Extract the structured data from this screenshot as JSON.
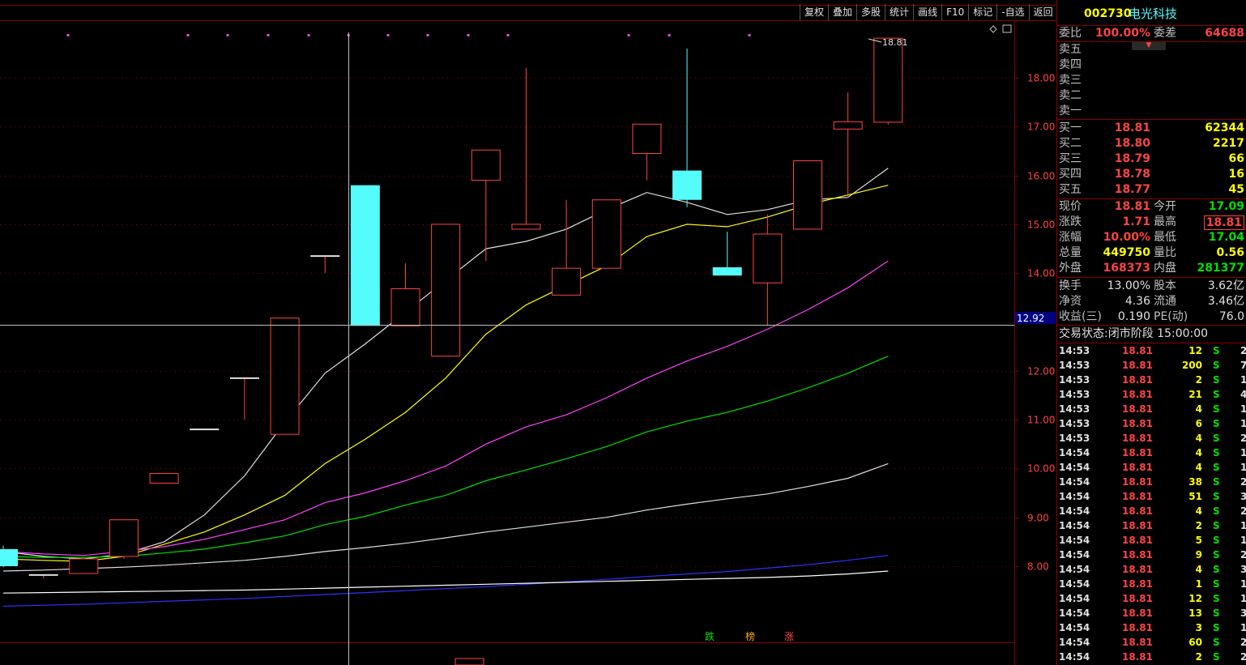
{
  "toolbar": {
    "buttons": [
      "复权",
      "叠加",
      "多股",
      "统计",
      "画线",
      "F10",
      "标记",
      "-自选",
      "返回"
    ]
  },
  "chart_data": {
    "type": "candlestick",
    "y_ticks": [
      "18.00",
      "17.00",
      "16.00",
      "15.00",
      "14.00",
      "12.00",
      "11.00",
      "10.00",
      "9.00",
      "8.00"
    ],
    "y_tick_values": [
      18,
      17,
      16,
      15,
      14,
      12,
      11,
      10,
      9,
      8
    ],
    "ylim": [
      6.3,
      19.1
    ],
    "crosshair_price": "12.92",
    "high_marker": "18.81",
    "bottom_labels": [
      "跌",
      "榜",
      "涨"
    ],
    "candles": [
      {
        "o": 8.35,
        "c": 8.0,
        "h": 8.42,
        "l": 7.98
      },
      {
        "o": 7.82,
        "c": 7.82,
        "h": 7.82,
        "l": 7.75
      },
      {
        "o": 7.85,
        "c": 8.15,
        "h": 8.15,
        "l": 7.85
      },
      {
        "o": 8.2,
        "c": 8.95,
        "h": 8.95,
        "l": 8.15
      },
      {
        "o": 9.7,
        "c": 9.9,
        "h": 9.9,
        "l": 9.7
      },
      {
        "o": 10.8,
        "c": 10.8,
        "h": 10.8,
        "l": 10.8
      },
      {
        "o": 11.85,
        "c": 11.85,
        "h": 11.85,
        "l": 11.0
      },
      {
        "o": 10.7,
        "c": 13.08,
        "h": 13.08,
        "l": 10.7
      },
      {
        "o": 14.35,
        "c": 14.35,
        "h": 14.35,
        "l": 14.0
      },
      {
        "o": 15.8,
        "c": 12.92,
        "h": 15.8,
        "l": 12.92
      },
      {
        "o": 12.92,
        "c": 13.68,
        "h": 14.2,
        "l": 12.92
      },
      {
        "o": 12.3,
        "c": 15.0,
        "h": 15.0,
        "l": 12.3
      },
      {
        "o": 15.9,
        "c": 16.52,
        "h": 16.52,
        "l": 14.25
      },
      {
        "o": 14.9,
        "c": 15.0,
        "h": 18.2,
        "l": 14.9
      },
      {
        "o": 13.55,
        "c": 14.1,
        "h": 15.5,
        "l": 13.55
      },
      {
        "o": 14.1,
        "c": 15.5,
        "h": 15.5,
        "l": 14.1
      },
      {
        "o": 16.45,
        "c": 17.05,
        "h": 17.05,
        "l": 15.9
      },
      {
        "o": 16.1,
        "c": 15.5,
        "h": 18.6,
        "l": 15.35
      },
      {
        "o": 14.12,
        "c": 13.95,
        "h": 14.85,
        "l": 13.95
      },
      {
        "o": 13.8,
        "c": 14.8,
        "h": 15.2,
        "l": 12.92
      },
      {
        "o": 14.9,
        "c": 16.3,
        "h": 16.3,
        "l": 14.9
      },
      {
        "o": 16.95,
        "c": 17.1,
        "h": 17.7,
        "l": 15.55
      },
      {
        "o": 17.09,
        "c": 18.81,
        "h": 18.81,
        "l": 17.04
      }
    ],
    "series": [
      {
        "color": "#e0e0e0",
        "values": [
          8.3,
          8.2,
          8.15,
          8.25,
          8.5,
          9.05,
          9.85,
          10.95,
          11.95,
          12.55,
          13.2,
          13.85,
          14.5,
          14.65,
          14.9,
          15.3,
          15.65,
          15.45,
          15.2,
          15.3,
          15.5,
          15.55,
          16.15
        ]
      },
      {
        "color": "#ffff00",
        "values": [
          8.15,
          8.12,
          8.1,
          8.2,
          8.45,
          8.7,
          9.05,
          9.45,
          10.1,
          10.6,
          11.15,
          11.85,
          12.75,
          13.35,
          13.75,
          14.15,
          14.75,
          15.0,
          14.95,
          15.15,
          15.4,
          15.6,
          15.8
        ]
      },
      {
        "color": "#ff40ff",
        "values": [
          8.3,
          8.25,
          8.22,
          8.3,
          8.4,
          8.55,
          8.75,
          8.95,
          9.3,
          9.5,
          9.75,
          10.05,
          10.5,
          10.85,
          11.1,
          11.45,
          11.85,
          12.2,
          12.5,
          12.85,
          13.25,
          13.7,
          14.25
        ]
      },
      {
        "color": "#00e000",
        "values": [
          8.2,
          8.18,
          8.18,
          8.2,
          8.27,
          8.35,
          8.48,
          8.62,
          8.85,
          9.02,
          9.25,
          9.45,
          9.75,
          9.97,
          10.2,
          10.45,
          10.75,
          10.97,
          11.15,
          11.38,
          11.65,
          11.95,
          12.3
        ]
      },
      {
        "color": "#e0e0e0",
        "values": [
          7.9,
          7.92,
          7.95,
          7.98,
          8.02,
          8.07,
          8.12,
          8.2,
          8.3,
          8.38,
          8.47,
          8.58,
          8.7,
          8.8,
          8.9,
          9.0,
          9.15,
          9.27,
          9.38,
          9.48,
          9.63,
          9.8,
          10.1
        ]
      },
      {
        "color": "#3030ff",
        "values": [
          7.18,
          7.2,
          7.22,
          7.25,
          7.28,
          7.31,
          7.34,
          7.38,
          7.42,
          7.46,
          7.5,
          7.54,
          7.58,
          7.63,
          7.68,
          7.73,
          7.79,
          7.84,
          7.89,
          7.96,
          8.03,
          8.12,
          8.22
        ]
      },
      {
        "color": "#ffffff",
        "values": [
          7.45,
          7.46,
          7.47,
          7.48,
          7.49,
          7.5,
          7.51,
          7.53,
          7.55,
          7.57,
          7.59,
          7.61,
          7.63,
          7.65,
          7.67,
          7.69,
          7.71,
          7.73,
          7.75,
          7.77,
          7.8,
          7.84,
          7.9
        ]
      }
    ]
  },
  "stock": {
    "code": "002730",
    "name": "电光科技"
  },
  "order_ratio": {
    "label": "委比",
    "value": "100.00%",
    "diff_label": "委差",
    "diff_value": "64688"
  },
  "sell_labels": [
    "卖五",
    "卖四",
    "卖三",
    "卖二",
    "卖一"
  ],
  "buy_book": [
    {
      "label": "买一",
      "price": "18.81",
      "vol": "62344"
    },
    {
      "label": "买二",
      "price": "18.80",
      "vol": "2217"
    },
    {
      "label": "买三",
      "price": "18.79",
      "vol": "66"
    },
    {
      "label": "买四",
      "price": "18.78",
      "vol": "16"
    },
    {
      "label": "买五",
      "price": "18.77",
      "vol": "45"
    }
  ],
  "quote": [
    {
      "l1": "现价",
      "v1": "18.81",
      "l2": "今开",
      "v2": "17.09"
    },
    {
      "l1": "涨跌",
      "v1": "1.71",
      "l2": "最高",
      "v2": "18.81"
    },
    {
      "l1": "涨幅",
      "v1": "10.00%",
      "l2": "最低",
      "v2": "17.04"
    },
    {
      "l1": "总量",
      "v1": "449750",
      "l2": "量比",
      "v2": "0.56"
    },
    {
      "l1": "外盘",
      "v1": "168373",
      "l2": "内盘",
      "v2": "281377"
    }
  ],
  "fundamentals": [
    {
      "l1": "换手",
      "v1": "13.00%",
      "l2": "股本",
      "v2": "3.62亿"
    },
    {
      "l1": "净资",
      "v1": "4.36",
      "l2": "流通",
      "v2": "3.46亿"
    },
    {
      "l1": "收益(三)",
      "v1": "0.190",
      "l2": "PE(动)",
      "v2": "76.0"
    }
  ],
  "trade_status": "交易状态:闭市阶段 15:00:00",
  "ticks": [
    [
      "14:53",
      "18.81",
      "12",
      "S",
      "2"
    ],
    [
      "14:53",
      "18.81",
      "200",
      "S",
      "7"
    ],
    [
      "14:53",
      "18.81",
      "2",
      "S",
      "1"
    ],
    [
      "14:53",
      "18.81",
      "21",
      "S",
      "4"
    ],
    [
      "14:53",
      "18.81",
      "4",
      "S",
      "1"
    ],
    [
      "14:53",
      "18.81",
      "6",
      "S",
      "1"
    ],
    [
      "14:53",
      "18.81",
      "4",
      "S",
      "2"
    ],
    [
      "14:54",
      "18.81",
      "4",
      "S",
      "1"
    ],
    [
      "14:54",
      "18.81",
      "4",
      "S",
      "1"
    ],
    [
      "14:54",
      "18.81",
      "38",
      "S",
      "2"
    ],
    [
      "14:54",
      "18.81",
      "51",
      "S",
      "3"
    ],
    [
      "14:54",
      "18.81",
      "4",
      "S",
      "2"
    ],
    [
      "14:54",
      "18.81",
      "2",
      "S",
      "1"
    ],
    [
      "14:54",
      "18.81",
      "5",
      "S",
      "1"
    ],
    [
      "14:54",
      "18.81",
      "9",
      "S",
      "2"
    ],
    [
      "14:54",
      "18.81",
      "4",
      "S",
      "3"
    ],
    [
      "14:54",
      "18.81",
      "1",
      "S",
      "1"
    ],
    [
      "14:54",
      "18.81",
      "12",
      "S",
      "1"
    ],
    [
      "14:54",
      "18.81",
      "13",
      "S",
      "3"
    ],
    [
      "14:54",
      "18.81",
      "3",
      "S",
      "1"
    ],
    [
      "14:54",
      "18.81",
      "60",
      "S",
      "2"
    ],
    [
      "14:54",
      "18.81",
      "2",
      "S",
      "2"
    ]
  ]
}
